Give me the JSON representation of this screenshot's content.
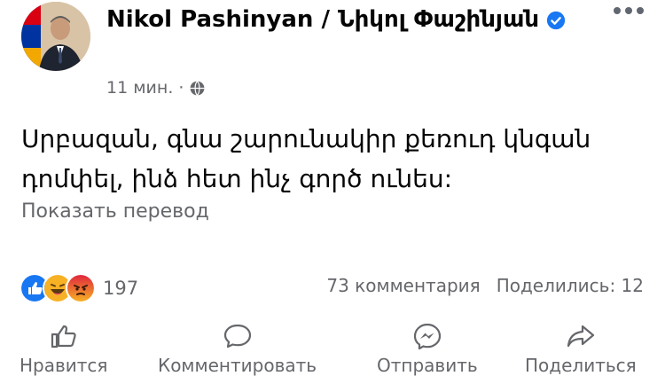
{
  "post": {
    "author": "Nikol Pashinyan / Նիկոլ Փաշինյան",
    "time": "11 мин. ·",
    "text": "Սրբազան, գնա շարունակիր քեռուդ կնգան դոմփել, ինձ հետ ինչ գործ ունես:",
    "translate_link": "Показать перевод"
  },
  "engagement": {
    "reaction_count": "197",
    "comments": "73 комментария",
    "shares": "Поделились: 12"
  },
  "actions": {
    "like": "Нравится",
    "comment": "Комментировать",
    "send": "Отправить",
    "share": "Поделиться"
  },
  "colors": {
    "like_blue": "#1877f2",
    "haha_yellow": "#f7b125",
    "angry_red": "#e9710f",
    "secondary_text": "#65676b"
  },
  "icons": {
    "verified": "verified-badge-icon",
    "privacy": "globe-icon",
    "more": "more-options-icon",
    "like": "thumbs-up-icon",
    "comment": "speech-bubble-icon",
    "send": "messenger-icon",
    "share": "share-arrow-icon"
  }
}
